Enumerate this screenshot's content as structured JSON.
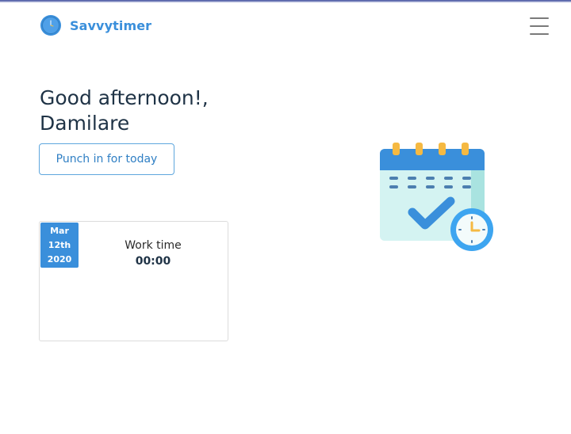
{
  "brand": {
    "name": "Savvytimer",
    "logo_icon": "clock-logo-icon",
    "color": "#3a8fdb"
  },
  "nav": {
    "menu_icon": "hamburger-menu-icon"
  },
  "greeting": {
    "line1": "Good afternoon!,",
    "line2": "Damilare"
  },
  "punch_button": {
    "label": "Punch in for today"
  },
  "day_card": {
    "date": {
      "month": "Mar",
      "day": "12th",
      "year": "2020"
    },
    "work_label": "Work time",
    "work_value": "00:00"
  },
  "illustration": {
    "icon": "calendar-check-clock-icon"
  },
  "colors": {
    "accent": "#3a8fdb",
    "heading": "#1f3346",
    "button_border": "#5ea6dd"
  }
}
